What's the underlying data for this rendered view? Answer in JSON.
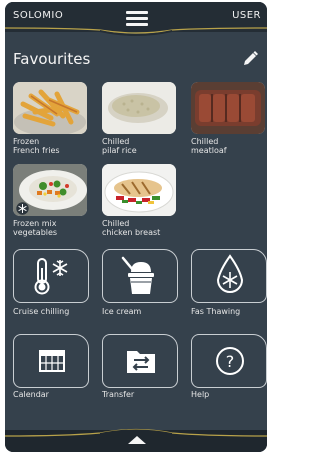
{
  "header": {
    "brand": "SOLOMIO",
    "user": "USER",
    "menu_icon": "hamburger-menu-icon"
  },
  "page": {
    "title": "Favourites",
    "edit_icon": "pencil-icon"
  },
  "favourites": [
    {
      "line1": "Frozen",
      "line2": "French fries"
    },
    {
      "line1": "Chilled",
      "line2": "pilaf rice"
    },
    {
      "line1": "Chilled",
      "line2": "meatloaf"
    },
    {
      "line1": "Frozen mix",
      "line2": "vegetables"
    },
    {
      "line1": "Chilled",
      "line2": "chicken breast"
    }
  ],
  "functions": [
    {
      "label": "Cruise chilling",
      "icon": "thermometer-snowflake-icon"
    },
    {
      "label": "Ice cream",
      "icon": "ice-cream-tub-icon"
    },
    {
      "label": "Fas Thawing",
      "icon": "drop-snowflake-icon"
    },
    {
      "label": "Calendar",
      "icon": "calendar-icon"
    },
    {
      "label": "Transfer",
      "icon": "transfer-folder-icon"
    },
    {
      "label": "Help",
      "icon": "help-question-icon"
    }
  ],
  "footer": {
    "icon": "expand-up-arrow-icon"
  },
  "colors": {
    "panel": "#35414c",
    "bar": "#242d35",
    "accent_gold": "#b8a24a",
    "text": "#f2f2f2"
  }
}
